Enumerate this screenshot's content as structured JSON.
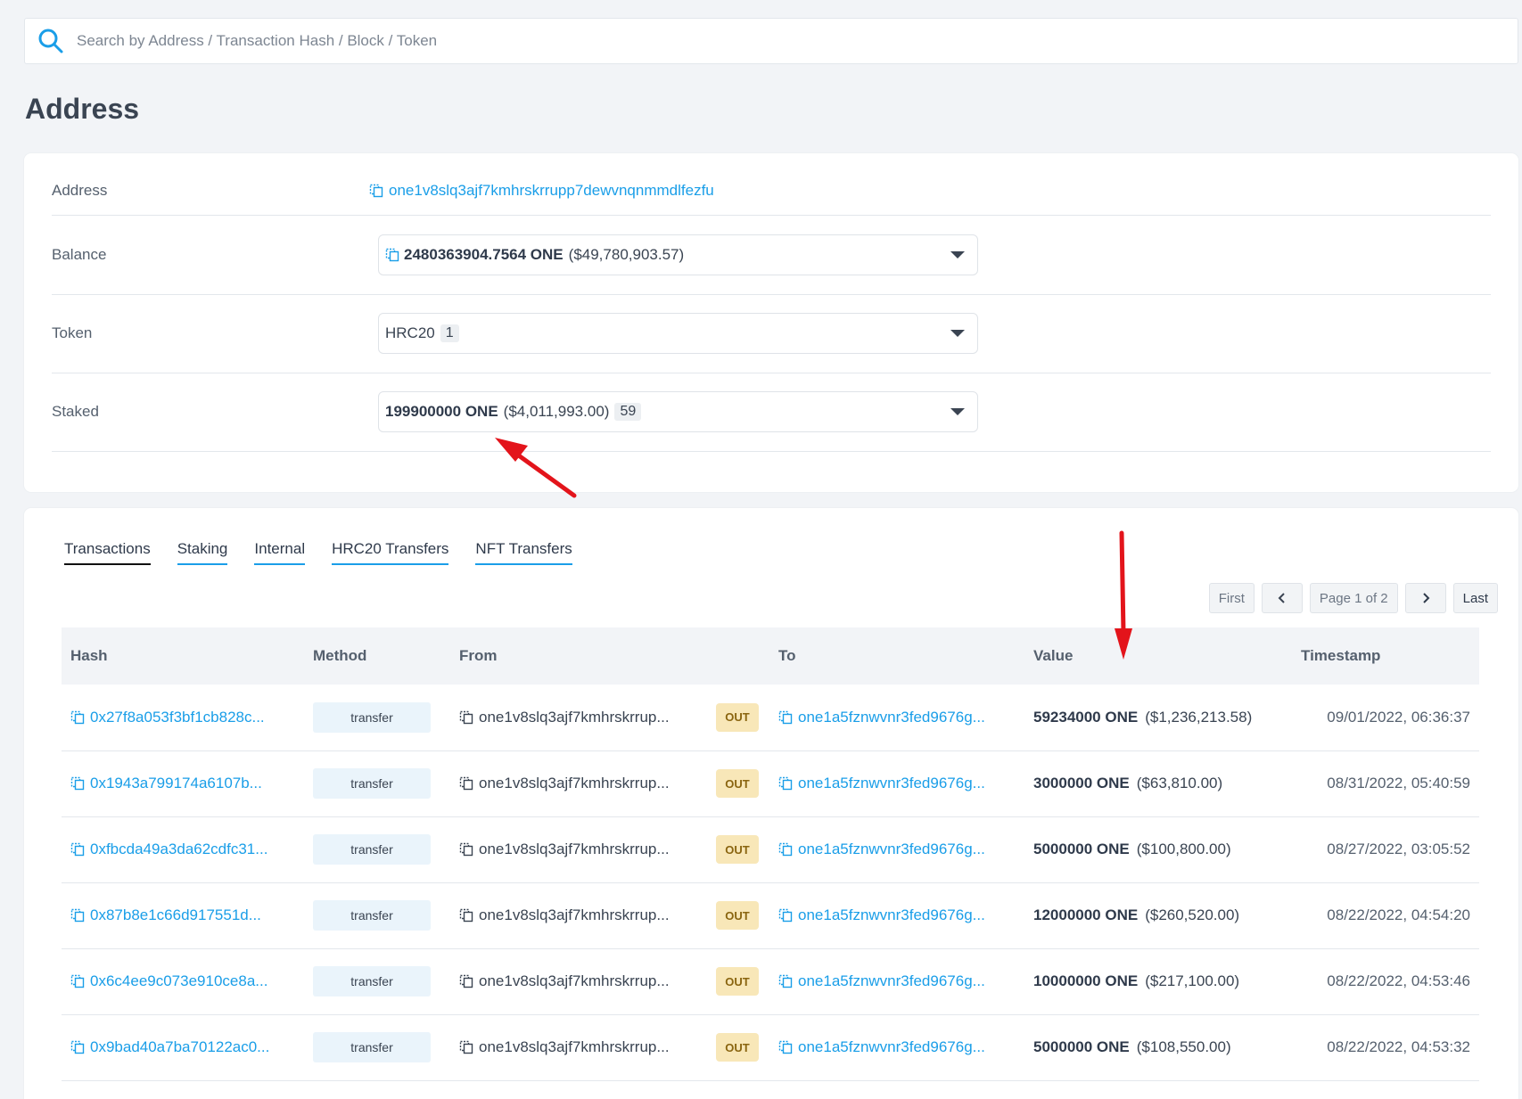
{
  "search": {
    "placeholder": "Search by Address / Transaction Hash / Block / Token"
  },
  "page": {
    "title": "Address"
  },
  "info": {
    "address_label": "Address",
    "address_value": "one1v8slq3ajf7kmhrskrrupp7dewvnqnmmdlfezfu",
    "balance_label": "Balance",
    "balance_amount": "2480363904.7564 ONE",
    "balance_usd": "($49,780,903.57)",
    "token_label": "Token",
    "token_type": "HRC20",
    "token_count": "1",
    "staked_label": "Staked",
    "staked_amount": "199900000 ONE",
    "staked_usd": "($4,011,993.00)",
    "staked_count": "59"
  },
  "tabs": [
    "Transactions",
    "Staking",
    "Internal",
    "HRC20 Transfers",
    "NFT Transfers"
  ],
  "pager": {
    "first": "First",
    "page": "Page 1 of 2",
    "last": "Last"
  },
  "table": {
    "headers": [
      "Hash",
      "Method",
      "From",
      "To",
      "Value",
      "Timestamp"
    ],
    "rows": [
      {
        "hash": "0x27f8a053f3bf1cb828c...",
        "method": "transfer",
        "from": "one1v8slq3ajf7kmhrskrrup...",
        "dir": "OUT",
        "to": "one1a5fznwvnr3fed9676g...",
        "amount": "59234000 ONE",
        "usd": "($1,236,213.58)",
        "ts": "09/01/2022, 06:36:37"
      },
      {
        "hash": "0x1943a799174a6107b...",
        "method": "transfer",
        "from": "one1v8slq3ajf7kmhrskrrup...",
        "dir": "OUT",
        "to": "one1a5fznwvnr3fed9676g...",
        "amount": "3000000 ONE",
        "usd": "($63,810.00)",
        "ts": "08/31/2022, 05:40:59"
      },
      {
        "hash": "0xfbcda49a3da62cdfc31...",
        "method": "transfer",
        "from": "one1v8slq3ajf7kmhrskrrup...",
        "dir": "OUT",
        "to": "one1a5fznwvnr3fed9676g...",
        "amount": "5000000 ONE",
        "usd": "($100,800.00)",
        "ts": "08/27/2022, 03:05:52"
      },
      {
        "hash": "0x87b8e1c66d917551d...",
        "method": "transfer",
        "from": "one1v8slq3ajf7kmhrskrrup...",
        "dir": "OUT",
        "to": "one1a5fznwvnr3fed9676g...",
        "amount": "12000000 ONE",
        "usd": "($260,520.00)",
        "ts": "08/22/2022, 04:54:20"
      },
      {
        "hash": "0x6c4ee9c073e910ce8a...",
        "method": "transfer",
        "from": "one1v8slq3ajf7kmhrskrrup...",
        "dir": "OUT",
        "to": "one1a5fznwvnr3fed9676g...",
        "amount": "10000000 ONE",
        "usd": "($217,100.00)",
        "ts": "08/22/2022, 04:53:46"
      },
      {
        "hash": "0x9bad40a7ba70122ac0...",
        "method": "transfer",
        "from": "one1v8slq3ajf7kmhrskrrup...",
        "dir": "OUT",
        "to": "one1a5fznwvnr3fed9676g...",
        "amount": "5000000 ONE",
        "usd": "($108,550.00)",
        "ts": "08/22/2022, 04:53:32"
      }
    ]
  },
  "colors": {
    "link": "#1a9ee8",
    "annotation_arrow": "#e3141b",
    "out_badge": "#f8e7b8"
  },
  "icons": {
    "search": "search-icon",
    "copy": "copy-icon",
    "caret": "caret-down-icon"
  }
}
